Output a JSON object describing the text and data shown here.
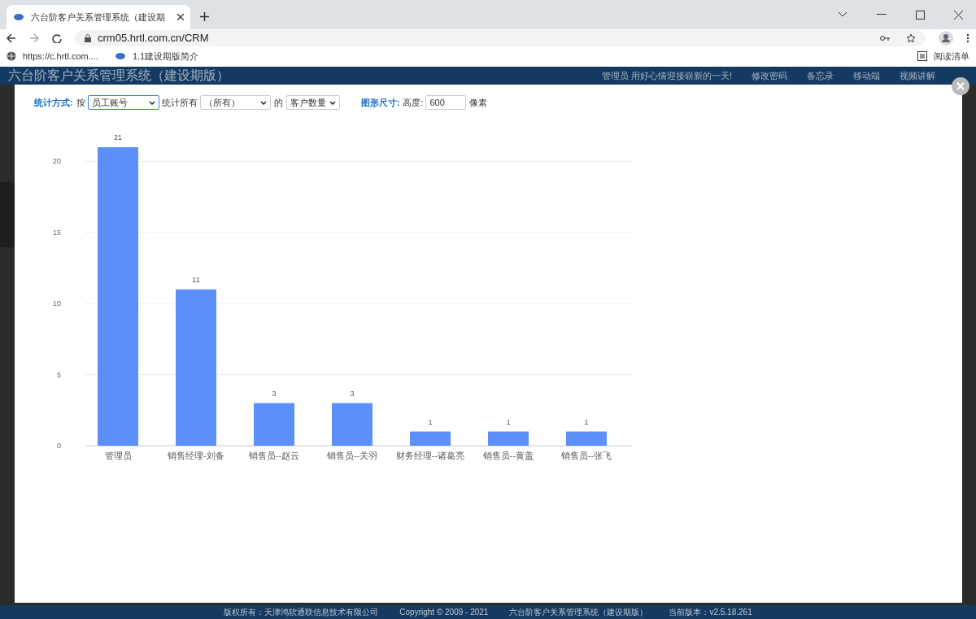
{
  "browser": {
    "tab_title": "六台阶客户关系管理系统（建设期",
    "url": "crm05.hrtl.com.cn/CRM",
    "bookmarks": [
      "https://c.hrtl.com....",
      "1.1建设期版简介"
    ],
    "reading_list": "阅读清单"
  },
  "app_header": {
    "title": "六台阶客户关系管理系统（建设期版）",
    "nav": [
      "管理员 用好心情迎接崭新的一天!",
      "修改密码",
      "备忘录",
      "移动端",
      "视频讲解"
    ]
  },
  "toolbar": {
    "stat_label": "统计方式:",
    "by": "按",
    "group_select": "员工账号",
    "count_all": "统计所有",
    "filter_select": "（所有）",
    "of": "的",
    "measure_select": "客户数量",
    "size_label": "图形尺寸:",
    "height_label": "高度:",
    "height_value": "600",
    "unit": "像素"
  },
  "chart_data": {
    "type": "bar",
    "categories": [
      "管理员",
      "销售经理-刘备",
      "销售员--赵云",
      "销售员--关羽",
      "财务经理--诸葛亮",
      "销售员--黄盖",
      "销售员--张飞"
    ],
    "series": [
      {
        "color": "#5b8ff9",
        "values": [
          21,
          11,
          3,
          3,
          1,
          1,
          1
        ]
      }
    ],
    "ylim": [
      0,
      21
    ],
    "yticks": [
      0,
      5,
      10,
      15,
      20
    ],
    "grid": true,
    "data_labels": true
  },
  "footer": [
    "版权所有：天津鸿软通联信息技术有限公司",
    "Copyright © 2009 - 2021",
    "六台阶客户关系管理系统（建设期版）",
    "当前版本：v2.5.18.261"
  ]
}
